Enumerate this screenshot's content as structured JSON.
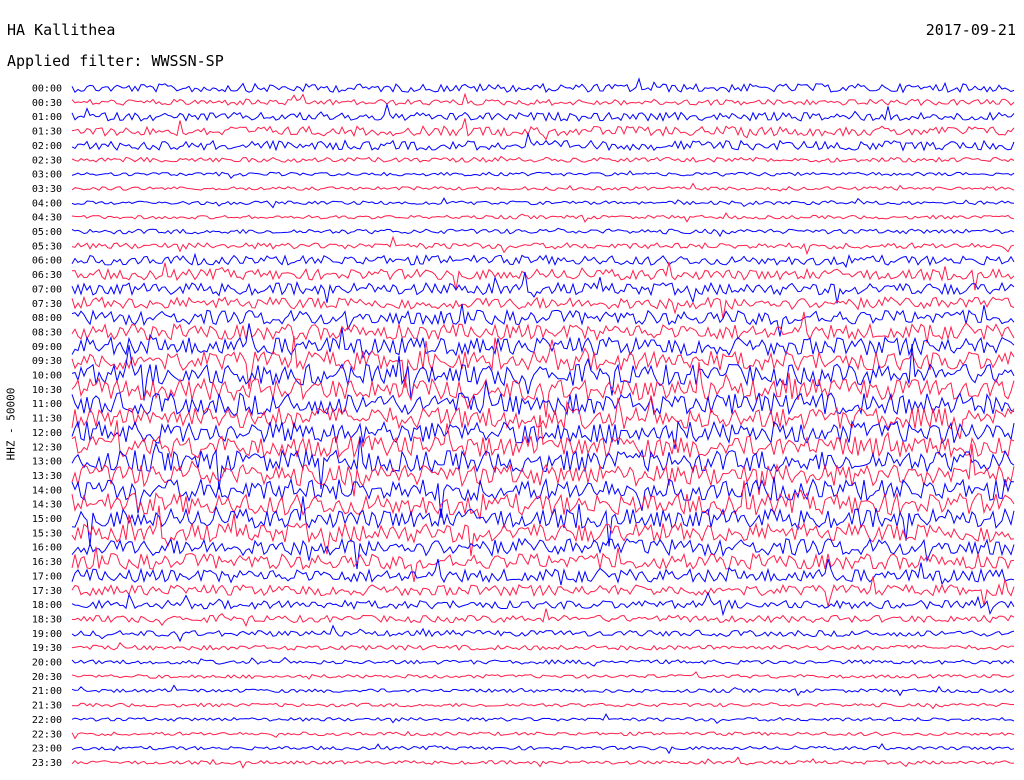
{
  "header": {
    "station": "HA Kallithea",
    "date": "2017-09-21",
    "filter": "Applied filter: WWSSN-SP"
  },
  "colors": {
    "trace_a": "#ff1f4b",
    "trace_b": "#0000ff",
    "background": "#ffffff"
  },
  "chart_data": {
    "type": "line",
    "title": "HA Kallithea",
    "date": "2017-09-21",
    "ylabel": "HHZ - 50000",
    "xlabel": "",
    "filter": "WWSSN-SP",
    "row_interval_minutes": 30,
    "grid": false,
    "trace_colors_alternating": [
      "#0000ff",
      "#ff1f4b"
    ],
    "row_labels": [
      "00:00",
      "00:30",
      "01:00",
      "01:30",
      "02:00",
      "02:30",
      "03:00",
      "03:30",
      "04:00",
      "04:30",
      "05:00",
      "05:30",
      "06:00",
      "06:30",
      "07:00",
      "07:30",
      "08:00",
      "08:30",
      "09:00",
      "09:30",
      "10:00",
      "10:30",
      "11:00",
      "11:30",
      "12:00",
      "12:30",
      "13:00",
      "13:30",
      "14:00",
      "14:30",
      "15:00",
      "15:30",
      "16:00",
      "16:30",
      "17:00",
      "17:30",
      "18:00",
      "18:30",
      "19:00",
      "19:30",
      "20:00",
      "20:30",
      "21:00",
      "21:30",
      "22:00",
      "22:30",
      "23:00",
      "23:30"
    ],
    "relative_activity": [
      0.7,
      0.5,
      0.7,
      0.8,
      0.8,
      0.4,
      0.3,
      0.3,
      0.3,
      0.3,
      0.4,
      0.5,
      0.8,
      0.9,
      1.0,
      1.0,
      1.2,
      1.3,
      1.5,
      1.6,
      1.8,
      1.8,
      1.8,
      1.8,
      1.8,
      1.8,
      1.8,
      1.8,
      1.8,
      1.8,
      1.6,
      1.6,
      1.4,
      1.3,
      1.1,
      0.9,
      0.7,
      0.6,
      0.5,
      0.4,
      0.35,
      0.3,
      0.3,
      0.3,
      0.3,
      0.3,
      0.3,
      0.3
    ]
  }
}
